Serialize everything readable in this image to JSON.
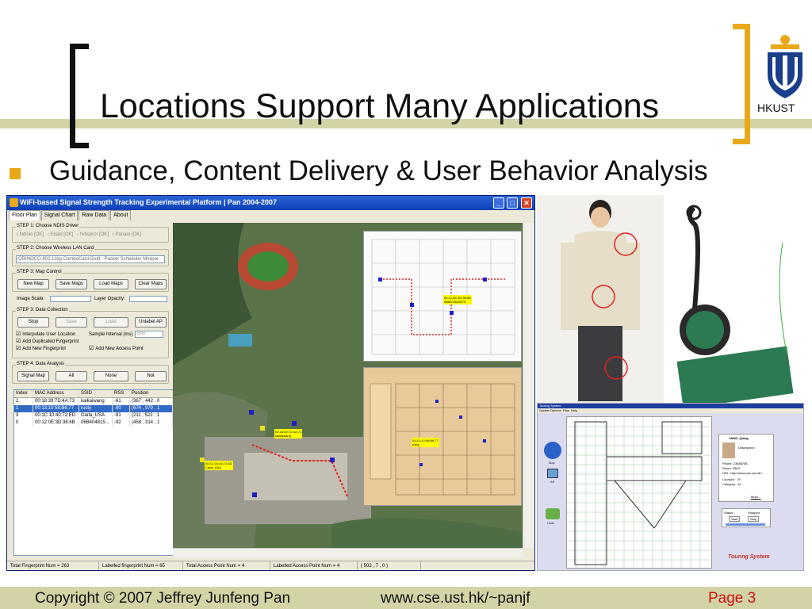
{
  "slide": {
    "title": "Locations Support Many Applications",
    "bullet": "Guidance, Content Delivery & User Behavior Analysis",
    "logo_text": "HKUST",
    "footer": {
      "copyright": "Copyright © 2007 Jeffrey Junfeng Pan",
      "url": "www.cse.ust.hk/~panjf",
      "page": "Page 3"
    },
    "colors": {
      "accent": "#e8a818",
      "band": "#d3d3a6",
      "page_num": "#d01010"
    }
  },
  "app": {
    "window_title": "WiFi-based Signal Strength Tracking Experimental Platform  |  Pan 2004-2007",
    "tabs": [
      "Floor Plan",
      "Signal Chart",
      "Raw Data",
      "About"
    ],
    "step1": {
      "title": "STEP 1: Choose NDIS Driver",
      "options": [
        "Ndisio [OK]",
        "Ekaio [OK]",
        "Ndisprot [OK]",
        "Panaio [OK]"
      ]
    },
    "step2": {
      "title": "STEP 2: Choose Wireless LAN Card",
      "selected": "ORINOCO 802.11bg ComboCard Gold - Packet Scheduler Minipor"
    },
    "step3": {
      "title": "STEP 3: Map Control",
      "buttons": [
        "New Map",
        "Save Maps",
        "Load Maps",
        "Clear Maps"
      ],
      "image_scale": "Image Scale:",
      "layer_opacity": "Layer Opacity:",
      "collection_title": "STEP 3: Data Collection",
      "collection_buttons": [
        "Stop",
        "Save",
        "Load",
        "Unlabel AP"
      ],
      "checks": [
        "Interpolate User Location",
        "Add Duplicated Fingerprint",
        "Add New Fingerprint",
        "Add New Access Point"
      ],
      "sample_interval_label": "Sample Interval (ms)",
      "sample_interval_value": "500"
    },
    "step4": {
      "title": "STEP 4: Data Analysis",
      "buttons": [
        "Signal Map",
        "All",
        "None",
        "Not"
      ]
    },
    "table": {
      "headers": [
        "Index",
        "MAC Address",
        "SSID",
        "RSS",
        "Position"
      ],
      "rows": [
        [
          "2",
          "00:18:39:7D:4A:73",
          "kaikaiwang",
          "-61",
          "(367 , 442 , 0"
        ],
        [
          "1",
          "00:13:10:58:B6:77",
          "rusty",
          "-90",
          "(674 , 979 , 1"
        ],
        [
          "3",
          "00:1C:10:40:72:ED",
          "Carla_USA",
          "-91",
          "(211 , 522 , 1"
        ],
        [
          "0",
          "00:12:0E:3D:36:6B",
          "06B404815...",
          "-92",
          "(458 , 314 , 1"
        ]
      ]
    },
    "map_labels": [
      {
        "text": "00:18:39:7D:4A:73\nkaikaiwang"
      },
      {
        "text": "00:1C:10:40:72:ED\nCarla_USA"
      },
      {
        "text": "00:12:0E:3D:36:6B\n06B404815079"
      },
      {
        "text": "00:13:10:58:B6:77\nrusty"
      }
    ],
    "status": [
      "Total Fingerprint Num = 263",
      "Labelled fingerprint Num = 65",
      "Total Access Point Num = 4",
      "Labelled Access Point Num = 4",
      "( 502 , 7 , 0 )"
    ]
  },
  "touring": {
    "title": "Touring System",
    "menu": [
      "System",
      "Options",
      "Plan",
      "Help"
    ],
    "profile": {
      "name": "YANG, Qiang",
      "description": "Description :",
      "phone": "Phone: 23586768",
      "room": "Room: 3563",
      "url": "URL: http://www.cse.ust.hk/~",
      "location": "Location :  3Y",
      "category": "Category :  AI",
      "more": "More..."
    },
    "status_label": "Status :",
    "status_value": "Stopped",
    "start": "Start",
    "stop": "Stop",
    "side": [
      "Map",
      "AR",
      "Hints"
    ]
  }
}
